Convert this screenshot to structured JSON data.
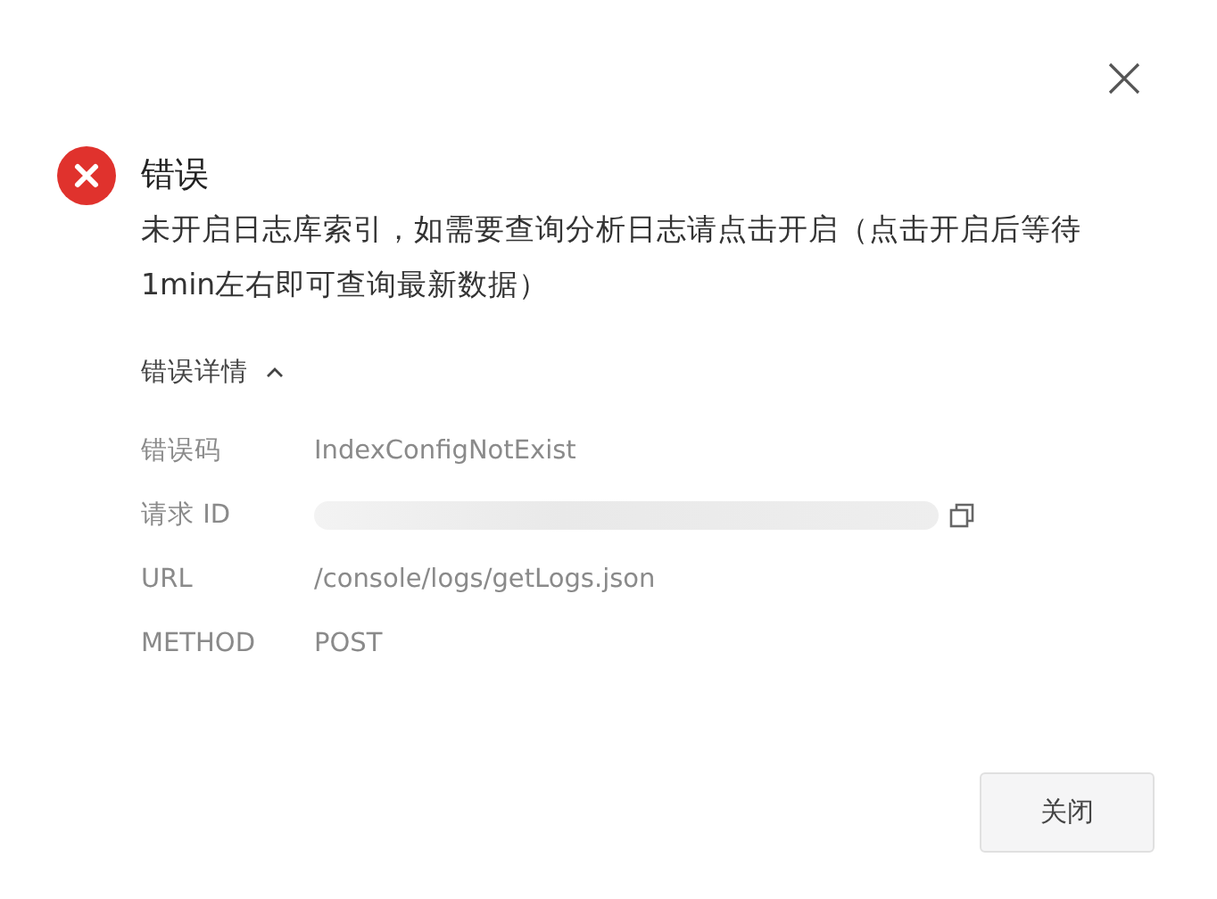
{
  "dialog": {
    "title": "错误",
    "message": "未开启日志库索引，如需要查询分析日志请点击开启（点击开启后等待1min左右即可查询最新数据）",
    "details": {
      "label": "错误详情",
      "expanded": true,
      "rows": [
        {
          "label": "错误码",
          "kind": "text",
          "value": "IndexConfigNotExist"
        },
        {
          "label": "请求 ID",
          "kind": "redacted"
        },
        {
          "label": "URL",
          "kind": "text",
          "value": "/console/logs/getLogs.json"
        },
        {
          "label": "METHOD",
          "kind": "text",
          "value": "POST"
        }
      ]
    },
    "buttons": [
      "关闭"
    ]
  }
}
